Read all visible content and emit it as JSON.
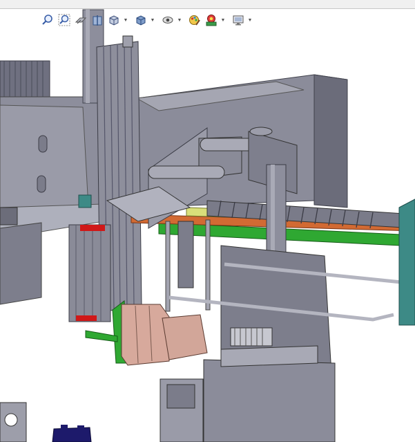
{
  "colors": {
    "background": "#ffffff",
    "metal_dark": "#6f7080",
    "metal_mid": "#8d8e9c",
    "metal_light": "#aeb0bc",
    "accent_green": "#2fa832",
    "accent_red": "#d01818",
    "accent_pink": "#d7a99c",
    "accent_teal": "#3d8a86",
    "accent_orange": "#d26a33",
    "accent_yellow": "#d9df7a",
    "accent_navy": "#1d1a6b"
  },
  "toolbar": {
    "buttons": [
      {
        "id": "zoom-to-fit",
        "icon": "zoom-to-fit-icon",
        "has_dropdown": false
      },
      {
        "id": "zoom-to-area",
        "icon": "zoom-to-area-icon",
        "has_dropdown": false
      },
      {
        "id": "previous-view",
        "icon": "previous-view-icon",
        "has_dropdown": false
      },
      {
        "id": "section-view",
        "icon": "section-view-icon",
        "has_dropdown": false
      },
      {
        "id": "view-orientation",
        "icon": "view-orientation-icon",
        "has_dropdown": true
      },
      {
        "id": "display-style",
        "icon": "display-style-icon",
        "has_dropdown": true
      },
      {
        "id": "hide-show-items",
        "icon": "hide-show-items-icon",
        "has_dropdown": true
      },
      {
        "id": "edit-appearance",
        "icon": "edit-appearance-icon",
        "has_dropdown": false
      },
      {
        "id": "apply-scene",
        "icon": "apply-scene-icon",
        "has_dropdown": true
      },
      {
        "id": "view-settings",
        "icon": "view-settings-icon",
        "has_dropdown": true
      }
    ]
  }
}
